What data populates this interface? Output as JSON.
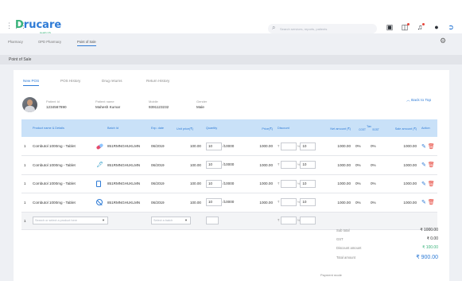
{
  "header": {
    "logo_text": "rucare",
    "logo_d": "D",
    "logo_sub": "Health OS",
    "search_placeholder": "Search services, reports, patients"
  },
  "nav": {
    "crumbs": [
      "Pharmacy",
      "OPD Pharmacy",
      "Point of Sale"
    ]
  },
  "page": {
    "title": "Point of Sale"
  },
  "tabs": [
    "New POS",
    "POS History",
    "Drug returns",
    "Return History"
  ],
  "patient": {
    "id_label": "Patient Id",
    "id": "1234567890",
    "name_label": "Patient name",
    "name": "Mahesh Kumar",
    "mobile_label": "Mobile",
    "mobile": "9391123232",
    "gender_label": "Gender",
    "gender": "Male",
    "back_to_top": "Back to Top"
  },
  "table": {
    "headers": [
      "Product name & Details",
      "Batch Id",
      "Exp. date",
      "Unit price(₹)",
      "Quantity",
      "Price(₹)",
      "Discount",
      "Net amount (₹)",
      "Tax",
      "Sale amount (₹)",
      "Action"
    ],
    "tax_sub": [
      "CGST",
      "SGST"
    ],
    "rows": [
      {
        "n": "1",
        "product": "Combutol 1000mg - Tablet",
        "icon": "pill",
        "batch": "851RMNGHUKLMN",
        "exp": "06/2019",
        "unit_price": "100.00",
        "qty": "10",
        "stock": "/10000",
        "price": "1000.00",
        "discount": "",
        "disc_pct": "10",
        "net": "1000.00",
        "cgst": "0%",
        "sgst": "0%",
        "sale": "1000.00"
      },
      {
        "n": "1",
        "product": "Combutol 1000mg - Tablet",
        "icon": "drop",
        "batch": "851RMNGHUKLMN",
        "exp": "06/2019",
        "unit_price": "100.00",
        "qty": "10",
        "stock": "/10000",
        "price": "1000.00",
        "discount": "",
        "disc_pct": "10",
        "net": "1000.00",
        "cgst": "0%",
        "sgst": "0%",
        "sale": "1000.00"
      },
      {
        "n": "1",
        "product": "Combutol 1000mg - Tablet",
        "icon": "tube",
        "batch": "851RMNGHUKLMN",
        "exp": "06/2019",
        "unit_price": "100.00",
        "qty": "10",
        "stock": "/10000",
        "price": "1000.00",
        "discount": "",
        "disc_pct": "10",
        "net": "1000.00",
        "cgst": "0%",
        "sgst": "0%",
        "sale": "1000.00"
      },
      {
        "n": "1",
        "product": "Combutol 1000mg - Tablet",
        "icon": "ban",
        "batch": "851RMNGHUKLMN",
        "exp": "06/2019",
        "unit_price": "100.00",
        "qty": "10",
        "stock": "/10000",
        "price": "1000.00",
        "discount": "",
        "disc_pct": "10",
        "net": "1000.00",
        "cgst": "0%",
        "sgst": "0%",
        "sale": "1000.00"
      }
    ],
    "input_row": {
      "n": "1",
      "product_placeholder": "Search or select a product here",
      "batch_placeholder": "Select a batch"
    }
  },
  "summary": {
    "sub_total_label": "Sub total",
    "sub_total": "₹ 1000.00",
    "gst_label": "GST",
    "gst": "₹ 0.00",
    "discount_label": "Discount amount",
    "discount": "₹ 100.00",
    "total_label": "Total amount",
    "total": "₹ 900.00",
    "payment_mode_label": "Payment mode"
  },
  "colors": {
    "accent": "#2e7bd6",
    "brand_green": "#38b27a",
    "header_blue": "#c9e1f8",
    "danger": "#e6453a"
  }
}
